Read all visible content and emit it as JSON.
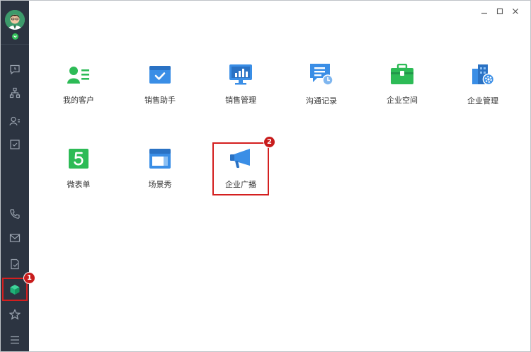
{
  "window": {
    "controls": [
      {
        "name": "minimize",
        "icon": "minimize-icon"
      },
      {
        "name": "maximize",
        "icon": "maximize-icon"
      },
      {
        "name": "close",
        "icon": "close-icon"
      }
    ]
  },
  "sidebar": {
    "avatar_icon": "user-avatar",
    "status_icon": "chevron-down-icon",
    "top_items": [
      {
        "id": "messages",
        "icon": "chat-clock-icon"
      },
      {
        "id": "org",
        "icon": "org-chart-icon"
      },
      {
        "id": "contacts",
        "icon": "contact-list-icon"
      },
      {
        "id": "tasks",
        "icon": "checkbox-icon"
      }
    ],
    "bottom_items": [
      {
        "id": "phone",
        "icon": "phone-icon"
      },
      {
        "id": "mail",
        "icon": "mail-icon"
      },
      {
        "id": "document",
        "icon": "document-icon"
      },
      {
        "id": "apps",
        "icon": "cube-icon",
        "active": true
      },
      {
        "id": "favorites",
        "icon": "star-icon"
      },
      {
        "id": "menu",
        "icon": "hamburger-icon"
      }
    ]
  },
  "badges": {
    "step1": "1",
    "step2": "2"
  },
  "apps": [
    {
      "label": "我的客户",
      "icon": "customer-card-icon",
      "color": "#2dbb56"
    },
    {
      "label": "销售助手",
      "icon": "calendar-check-icon",
      "color": "#3a8ee6"
    },
    {
      "label": "销售管理",
      "icon": "monitor-chart-icon",
      "color": "#3a8ee6"
    },
    {
      "label": "沟通记录",
      "icon": "chat-record-icon",
      "color": "#3a8ee6"
    },
    {
      "label": "企业空间",
      "icon": "briefcase-icon",
      "color": "#2dbb56"
    },
    {
      "label": "企业管理",
      "icon": "building-gear-icon",
      "color": "#3a8ee6"
    },
    {
      "label": "微表单",
      "icon": "form-five-icon",
      "color": "#2dbb56"
    },
    {
      "label": "场景秀",
      "icon": "scene-window-icon",
      "color": "#3a8ee6"
    },
    {
      "label": "企业广播",
      "icon": "megaphone-icon",
      "color": "#3a8ee6"
    }
  ],
  "colors": {
    "sidebar": "#2c3441",
    "highlight": "#d41f1f",
    "green": "#2dbb56",
    "blue": "#3a8ee6"
  }
}
